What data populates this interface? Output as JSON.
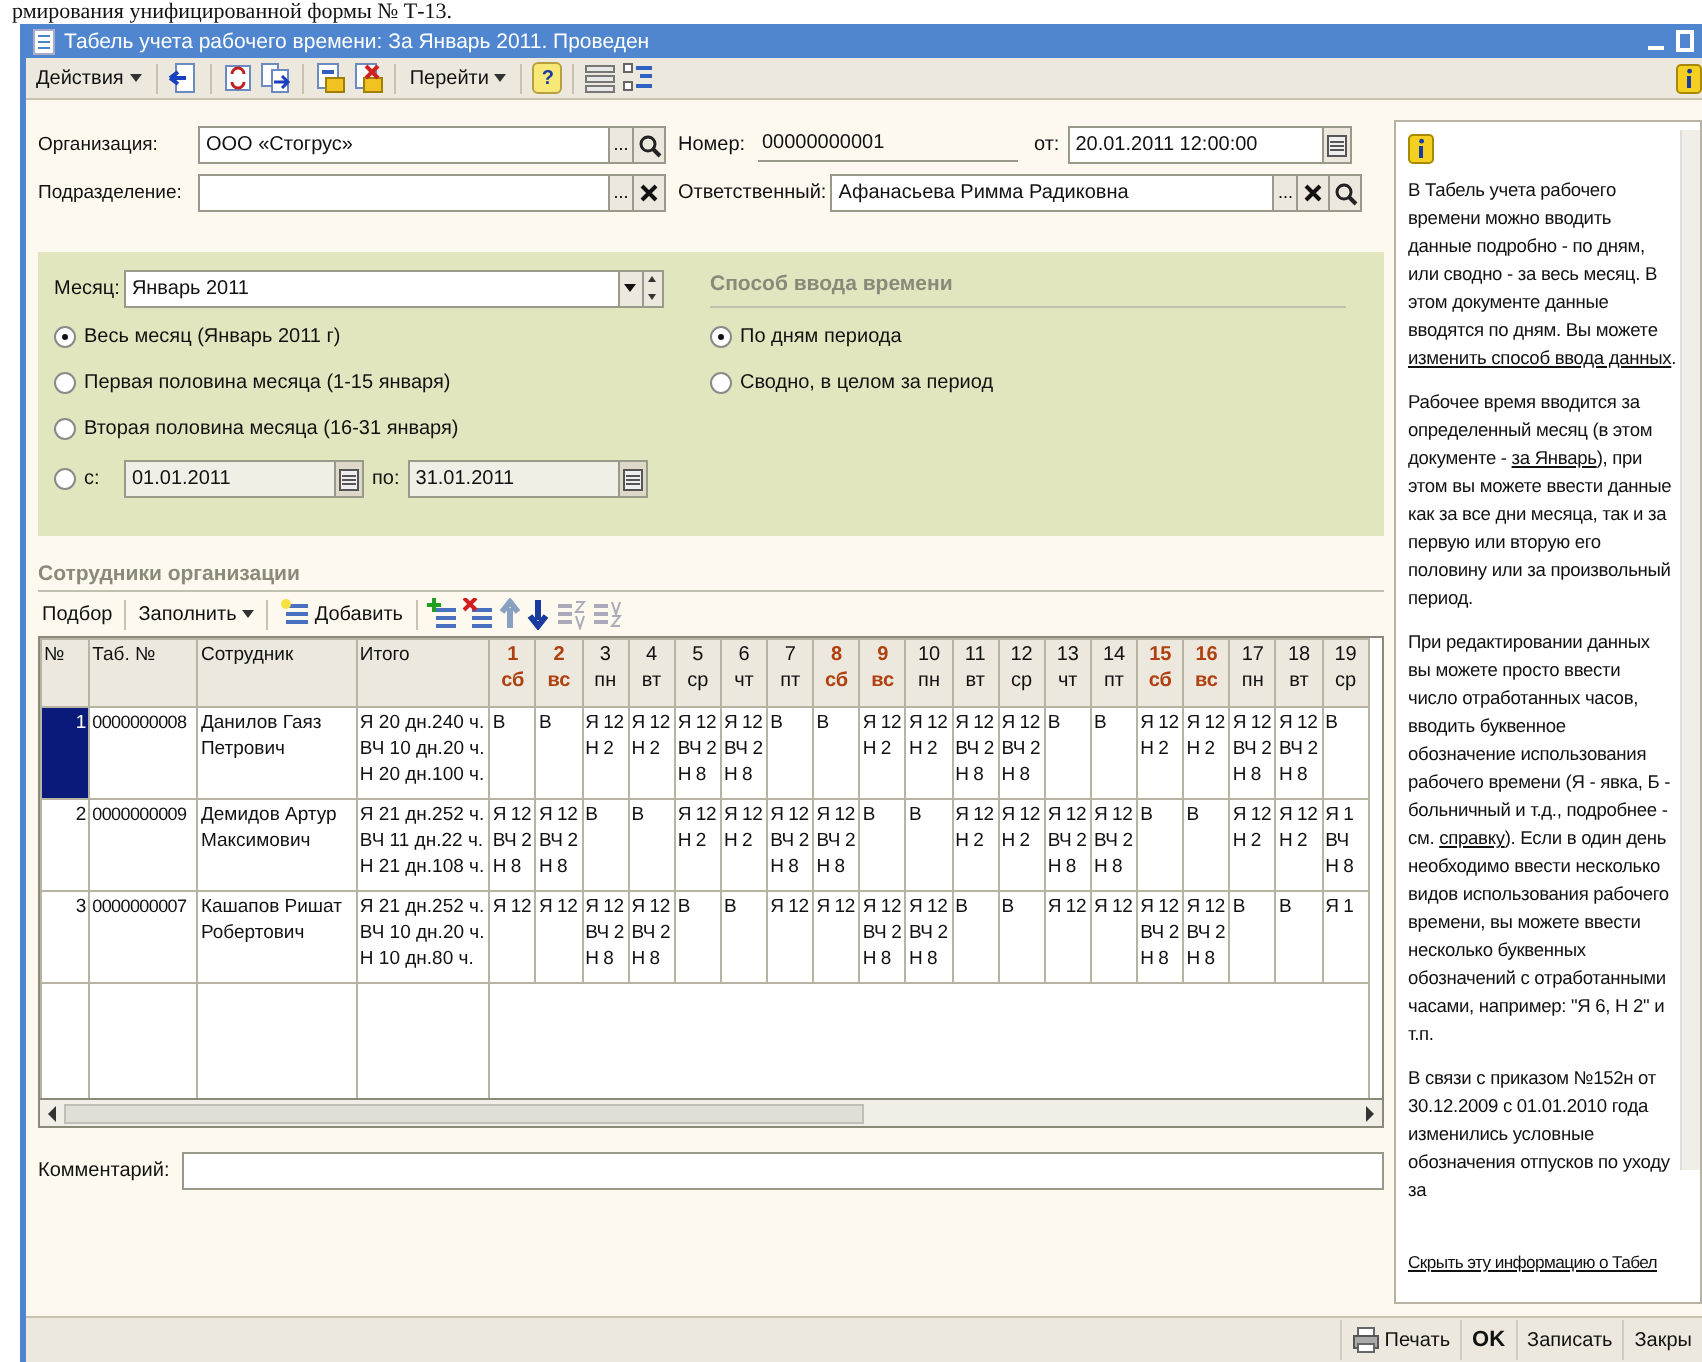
{
  "document_text": "рмирования унифицированной формы № Т-13.",
  "window": {
    "title": "Табель учета рабочего времени: За Январь 2011. Проведен"
  },
  "toolbar": {
    "actions": "Действия",
    "goto": "Перейти",
    "help": "?"
  },
  "header": {
    "organization": {
      "label": "Организация:",
      "value": "ООО «Стогрус»",
      "select": "..."
    },
    "number": {
      "label": "Номер:",
      "value": "00000000001"
    },
    "date": {
      "label": "от:",
      "value": "20.01.2011 12:00:00"
    },
    "department": {
      "label": "Подразделение:",
      "select": "..."
    },
    "responsible": {
      "label": "Ответственный:",
      "value": "Афанасьева Римма Радиковна",
      "select": "..."
    }
  },
  "period": {
    "month_label": "Месяц:",
    "month": "Январь 2011",
    "options": [
      {
        "label": "Весь месяц (Январь 2011 г)",
        "selected": true
      },
      {
        "label": "Первая половина месяца (1-15 января)",
        "selected": false
      },
      {
        "label": "Вторая половина месяца (16-31 января)",
        "selected": false
      },
      {
        "label": "с:",
        "selected": false
      }
    ],
    "from": {
      "value": "01.01.2011",
      "disabled": true
    },
    "to_label": "по:",
    "to": {
      "value": "31.01.2011",
      "disabled": true
    },
    "input_heading": "Способ ввода времени",
    "input_options": [
      {
        "label": "По дням периода",
        "selected": true
      },
      {
        "label": "Сводно, в целом за период",
        "selected": false
      }
    ]
  },
  "employees": {
    "heading": "Сотрудники организации",
    "toolbar": {
      "pick": "Подбор",
      "fill": "Заполнить",
      "add": "Добавить"
    },
    "columns": [
      "№",
      "Таб. №",
      "Сотрудник",
      "Итого"
    ],
    "days": [
      {
        "day": "1",
        "weekday": "сб",
        "weekend": true
      },
      {
        "day": "2",
        "weekday": "вс",
        "weekend": true
      },
      {
        "day": "3",
        "weekday": "пн",
        "weekend": false
      },
      {
        "day": "4",
        "weekday": "вт",
        "weekend": false
      },
      {
        "day": "5",
        "weekday": "ср",
        "weekend": false
      },
      {
        "day": "6",
        "weekday": "чт",
        "weekend": false
      },
      {
        "day": "7",
        "weekday": "пт",
        "weekend": false
      },
      {
        "day": "8",
        "weekday": "сб",
        "weekend": true
      },
      {
        "day": "9",
        "weekday": "вс",
        "weekend": true
      },
      {
        "day": "10",
        "weekday": "пн",
        "weekend": false
      },
      {
        "day": "11",
        "weekday": "вт",
        "weekend": false
      },
      {
        "day": "12",
        "weekday": "ср",
        "weekend": false
      },
      {
        "day": "13",
        "weekday": "чт",
        "weekend": false
      },
      {
        "day": "14",
        "weekday": "пт",
        "weekend": false
      },
      {
        "day": "15",
        "weekday": "сб",
        "weekend": true
      },
      {
        "day": "16",
        "weekday": "вс",
        "weekend": true
      },
      {
        "day": "17",
        "weekday": "пн",
        "weekend": false
      },
      {
        "day": "18",
        "weekday": "вт",
        "weekend": false
      },
      {
        "day": "19",
        "weekday": "ср",
        "weekend": false
      }
    ],
    "rows": [
      {
        "n": "1",
        "tab": "0000000008",
        "name": "Данилов Гаяз Петрович",
        "total": "Я 20 дн.240 ч.\nВЧ 10 дн.20 ч.\nН 20 дн.100 ч.",
        "selected": true,
        "days": [
          "В",
          "В",
          "Я 12\nН 2",
          "Я 12\nН 2",
          "Я 12\nВЧ 2\nН 8",
          "Я 12\nВЧ 2\nН 8",
          "В",
          "В",
          "Я 12\nН 2",
          "Я 12\nН 2",
          "Я 12\nВЧ 2\nН 8",
          "Я 12\nВЧ 2\nН 8",
          "В",
          "В",
          "Я 12\nН 2",
          "Я 12\nН 2",
          "Я 12\nВЧ 2\nН 8",
          "Я 12\nВЧ 2\nН 8",
          "В"
        ]
      },
      {
        "n": "2",
        "tab": "0000000009",
        "name": "Демидов Артур Максимович",
        "total": "Я 21 дн.252 ч.\nВЧ 11 дн.22 ч.\nН 21 дн.108 ч.",
        "selected": false,
        "days": [
          "Я 12\nВЧ 2\nН 8",
          "Я 12\nВЧ 2\nН 8",
          "В",
          "В",
          "Я 12\nН 2",
          "Я 12\nН 2",
          "Я 12\nВЧ 2\nН 8",
          "Я 12\nВЧ 2\nН 8",
          "В",
          "В",
          "Я 12\nН 2",
          "Я 12\nН 2",
          "Я 12\nВЧ 2\nН 8",
          "Я 12\nВЧ 2\nН 8",
          "В",
          "В",
          "Я 12\nН 2",
          "Я 12\nН 2",
          "Я 1\nВЧ\nН 8"
        ]
      },
      {
        "n": "3",
        "tab": "0000000007",
        "name": "Кашапов Ришат Робертович",
        "total": "Я 21 дн.252 ч.\nВЧ 10 дн.20 ч.\nН 10 дн.80 ч.",
        "selected": false,
        "days": [
          "Я 12",
          "Я 12",
          "Я 12\nВЧ 2\nН 8",
          "Я 12\nВЧ 2\nН 8",
          "В",
          "В",
          "Я 12",
          "Я 12",
          "Я 12\nВЧ 2\nН 8",
          "Я 12\nВЧ 2\nН 8",
          "В",
          "В",
          "Я 12",
          "Я 12",
          "Я 12\nВЧ 2\nН 8",
          "Я 12\nВЧ 2\nН 8",
          "В",
          "В",
          "Я 1"
        ]
      }
    ]
  },
  "comment": {
    "label": "Комментарий:"
  },
  "info": {
    "paragraphs": [
      [
        {
          "text": "В Табель учета рабочего времени можно вводить данные подробно - по дням, или сводно - за весь месяц. В этом документе данные вводятся по дням. Вы можете "
        },
        {
          "link": "изменить способ ввода данных"
        },
        {
          "text": "."
        }
      ],
      [
        {
          "text": "Рабочее время вводится за определенный месяц (в этом документе - "
        },
        {
          "link": "за Январь"
        },
        {
          "text": "), при этом вы можете ввести данные как за все дни месяца, так и за первую или вторую его половину или за произвольный период."
        }
      ],
      [
        {
          "text": "При редактировании данных вы можете просто ввести число отработанных часов, вводить буквенное обозначение использования рабочего времени (Я - явка, Б - больничный и т.д., подробнее - см. "
        },
        {
          "link": "справку"
        },
        {
          "text": "). Если в один день необходимо ввести несколько видов использования рабочего времени, вы можете ввести несколько буквенных обозначений с отработанными часами, например: \"Я 6, Н 2\" и т.п."
        }
      ],
      [
        {
          "text": "В связи с приказом №152н от 30.12.2009 с 01.01.2010 года изменились условные обозначения отпусков по уходу за"
        }
      ]
    ],
    "hide_link": "Скрыть эту информацию о Табел"
  },
  "footer": {
    "print": "Печать",
    "ok": "OK",
    "save": "Записать",
    "close": "Закры"
  }
}
